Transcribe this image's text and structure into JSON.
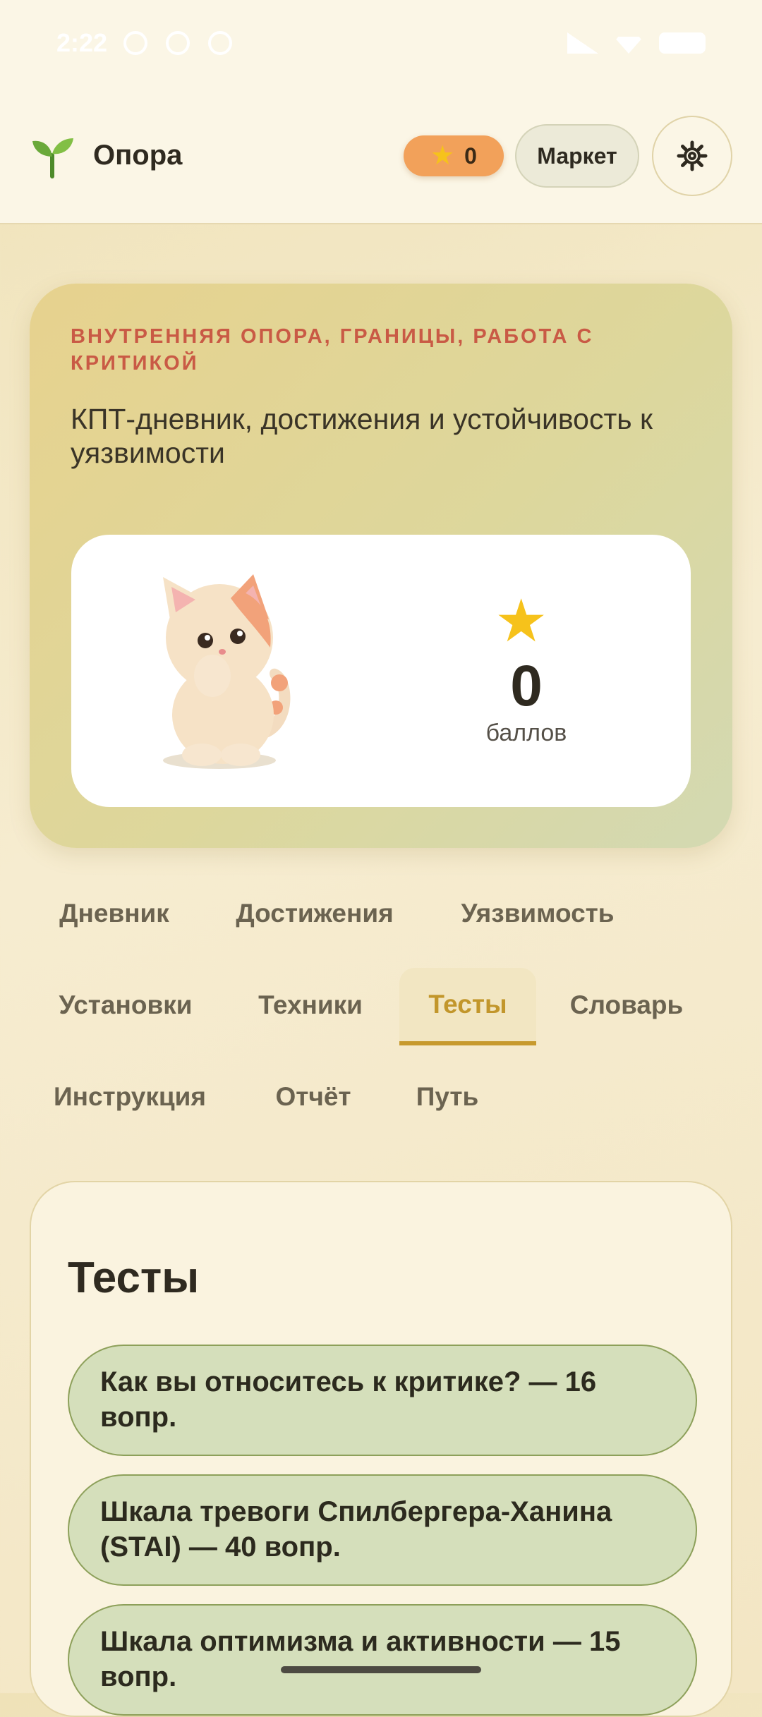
{
  "status_bar": {
    "time": "2:22"
  },
  "header": {
    "title": "Опора",
    "points": "0",
    "market_label": "Маркет"
  },
  "hero": {
    "subtitle": "Внутренняя опора, границы, работа с критикой",
    "description": "КПТ-дневник, достижения и устойчивость к уязвимости",
    "score_value": "0",
    "score_label": "баллов"
  },
  "tabs": [
    {
      "label": "Дневник"
    },
    {
      "label": "Достижения"
    },
    {
      "label": "Уязвимость"
    },
    {
      "label": "Установки"
    },
    {
      "label": "Техники"
    },
    {
      "label": "Тесты",
      "active": true
    },
    {
      "label": "Словарь"
    },
    {
      "label": "Инструкция"
    },
    {
      "label": "Отчёт"
    },
    {
      "label": "Путь"
    }
  ],
  "panel": {
    "title": "Тесты",
    "tests": [
      {
        "label": "Как вы относитесь к критике? — 16 вопр."
      },
      {
        "label": "Шкала тревоги Спилбергера-Ханина (STAI) — 40 вопр."
      },
      {
        "label": "Шкала оптимизма и активности — 15 вопр."
      }
    ]
  },
  "colors": {
    "accent": "#c79a2e",
    "subtitle": "#c95a45",
    "points_pill": "#f2a15a",
    "test_item_bg": "#d5dfbb"
  },
  "icons": {
    "logo": "seedling-icon",
    "points": "star-icon",
    "settings": "gear-icon",
    "mascot": "cat-mascot"
  }
}
